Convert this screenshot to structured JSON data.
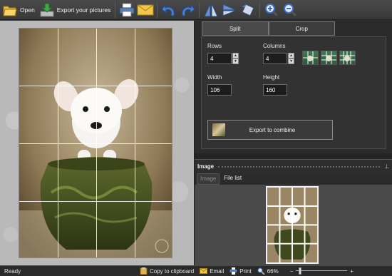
{
  "toolbar": {
    "open_label": "Open",
    "export_label": "Export your pictures",
    "icons": [
      "folder-open-icon",
      "export-down-icon",
      "print-icon",
      "email-icon",
      "undo-icon",
      "redo-icon",
      "flip-horizontal-icon",
      "flip-vertical-icon",
      "rotate-icon",
      "zoom-in-icon",
      "zoom-out-icon"
    ]
  },
  "canvas": {
    "grid_rows": 4,
    "grid_columns": 4,
    "image_subject": "white-puppy-in-green-pot"
  },
  "split_panel": {
    "tabs": [
      {
        "label": "Split",
        "active": true
      },
      {
        "label": "Crop",
        "active": false
      }
    ],
    "rows_label": "Rows",
    "rows_value": "4",
    "columns_label": "Columns",
    "columns_value": "4",
    "width_label": "Width",
    "width_value": "106",
    "height_label": "Height",
    "height_value": "160",
    "export_combine_label": "Export to combine",
    "presets": [
      "grid-preset-1-icon",
      "grid-preset-2-icon",
      "grid-preset-3-icon"
    ]
  },
  "image_panel": {
    "title": "Image",
    "pin_icon": "pin-icon",
    "tabs": [
      {
        "label": "Image",
        "active": false
      },
      {
        "label": "File list",
        "active": true
      }
    ]
  },
  "statusbar": {
    "status": "Ready",
    "copy_label": "Copy to clipboard",
    "email_label": "Email",
    "print_label": "Print",
    "zoom_label": "66%",
    "zoom_minus": "−",
    "zoom_plus": "+",
    "zoom_level_fraction": 0.66
  },
  "colors": {
    "accent_blue": "#3a6fc4",
    "background": "#2f2f2f",
    "canvas_bg": "#b9b9b9"
  }
}
